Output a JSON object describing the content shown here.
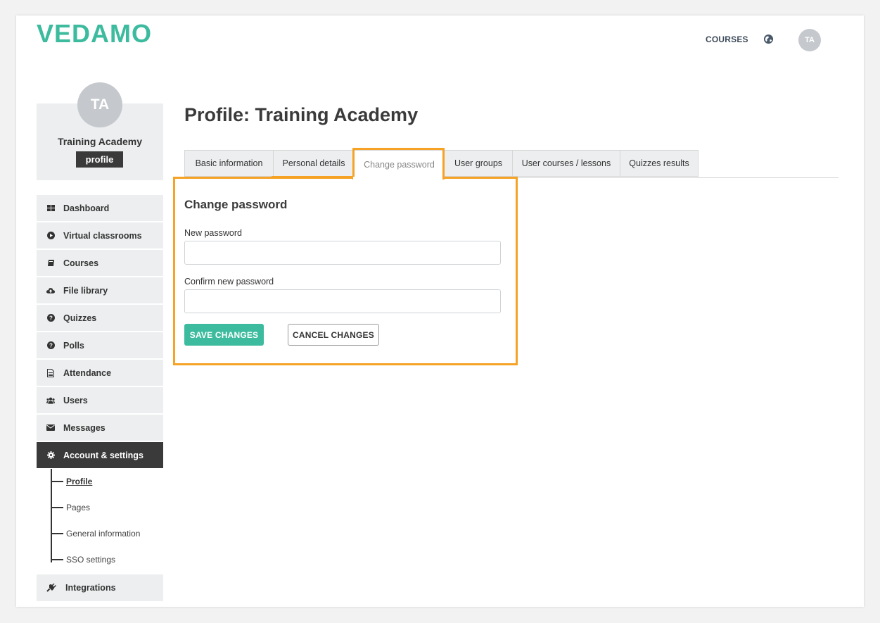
{
  "brand": {
    "logo_text": "VEDAMO",
    "logo_color": "#3dbb9e",
    "logo_dark": "#1e9e7f"
  },
  "header": {
    "courses_label": "COURSES",
    "globe_icon": "globe-icon",
    "avatar_initials": "TA"
  },
  "profile_card": {
    "initials": "TA",
    "name": "Training Academy",
    "badge": "profile"
  },
  "sidebar": {
    "items": [
      {
        "label": "Dashboard",
        "icon": "grid-icon"
      },
      {
        "label": "Virtual classrooms",
        "icon": "play-circle-icon"
      },
      {
        "label": "Courses",
        "icon": "book-icon"
      },
      {
        "label": "File library",
        "icon": "cloud-upload-icon"
      },
      {
        "label": "Quizzes",
        "icon": "question-circle-icon"
      },
      {
        "label": "Polls",
        "icon": "question-circle-icon"
      },
      {
        "label": "Attendance",
        "icon": "document-icon"
      },
      {
        "label": "Users",
        "icon": "users-icon"
      },
      {
        "label": "Messages",
        "icon": "envelope-icon"
      },
      {
        "label": "Account & settings",
        "icon": "gear-icon",
        "active": true
      }
    ],
    "subitems": [
      {
        "label": "Profile",
        "current": true
      },
      {
        "label": "Pages"
      },
      {
        "label": "General information"
      },
      {
        "label": "SSO settings"
      }
    ],
    "integrations": {
      "label": "Integrations",
      "icon": "plug-icon"
    }
  },
  "main": {
    "title": "Profile: Training Academy",
    "tabs": [
      {
        "label": "Basic information"
      },
      {
        "label": "Personal details"
      },
      {
        "label": "Change password",
        "active": true
      },
      {
        "label": "User groups"
      },
      {
        "label": "User courses / lessons"
      },
      {
        "label": "Quizzes results"
      }
    ],
    "form": {
      "title": "Change password",
      "new_password_label": "New password",
      "new_password_value": "",
      "confirm_password_label": "Confirm new password",
      "confirm_password_value": "",
      "save_label": "SAVE CHANGES",
      "cancel_label": "CANCEL CHANGES"
    }
  },
  "colors": {
    "accent": "#3dbb9e",
    "highlight": "#f5a225",
    "active_menu": "#3a3a3a"
  }
}
